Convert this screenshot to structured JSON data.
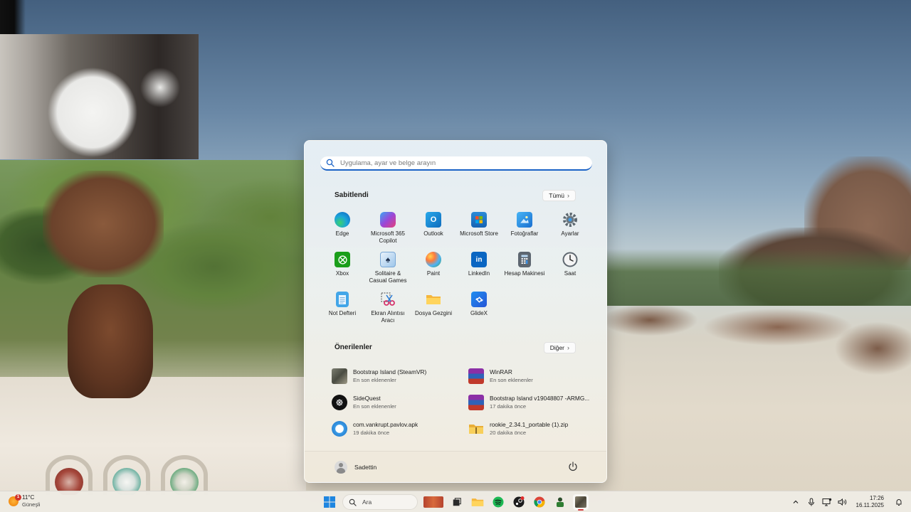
{
  "start_menu": {
    "search_placeholder": "Uygulama, ayar ve belge arayın",
    "pinned_title": "Sabitlendi",
    "all_button": "Tümü",
    "pinned_apps": [
      {
        "label": "Edge",
        "icon": "edge-icon"
      },
      {
        "label": "Microsoft 365 Copilot",
        "icon": "microsoft-365-copilot-icon"
      },
      {
        "label": "Outlook",
        "icon": "outlook-icon"
      },
      {
        "label": "Microsoft Store",
        "icon": "store-icon"
      },
      {
        "label": "Fotoğraflar",
        "icon": "photos-icon"
      },
      {
        "label": "Ayarlar",
        "icon": "gear-icon"
      },
      {
        "label": "Xbox",
        "icon": "xbox-icon"
      },
      {
        "label": "Solitaire & Casual Games",
        "icon": "solitaire-icon"
      },
      {
        "label": "Paint",
        "icon": "paint-icon"
      },
      {
        "label": "LinkedIn",
        "icon": "linkedin-icon"
      },
      {
        "label": "Hesap Makinesi",
        "icon": "calculator-icon"
      },
      {
        "label": "Saat",
        "icon": "clock-icon"
      },
      {
        "label": "Not Defteri",
        "icon": "notepad-icon"
      },
      {
        "label": "Ekran Alıntısı Aracı",
        "icon": "snipping-tool-icon"
      },
      {
        "label": "Dosya Gezgini",
        "icon": "folder-icon"
      },
      {
        "label": "GlideX",
        "icon": "glidex-icon"
      }
    ],
    "recommended_title": "Önerilenler",
    "more_button": "Diğer",
    "recommended": [
      {
        "name": "Bootstrap Island (SteamVR)",
        "sub": "En son eklenenler",
        "icon": "game-thumbnail-icon"
      },
      {
        "name": "WinRAR",
        "sub": "En son eklenenler",
        "icon": "winrar-icon"
      },
      {
        "name": "SideQuest",
        "sub": "En son eklenenler",
        "icon": "sidequest-icon"
      },
      {
        "name": "Bootstrap Island v19048807 -ARMG...",
        "sub": "17 dakika önce",
        "icon": "rar-archive-icon"
      },
      {
        "name": "com.vankrupt.pavlov.apk",
        "sub": "19 dakika önce",
        "icon": "apk-file-icon"
      },
      {
        "name": "rookie_2.34.1_portable (1).zip",
        "sub": "20 dakika önce",
        "icon": "zip-folder-icon"
      }
    ],
    "user_name": "Sadettin"
  },
  "taskbar": {
    "weather_temp": "11°C",
    "weather_condition": "Güneşli",
    "weather_badge": "1",
    "search_label": "Ara",
    "time": "17:26",
    "date": "16.11.2025"
  },
  "colors": {
    "accent": "#1b63c6",
    "active_indicator": "#d23c3c"
  }
}
